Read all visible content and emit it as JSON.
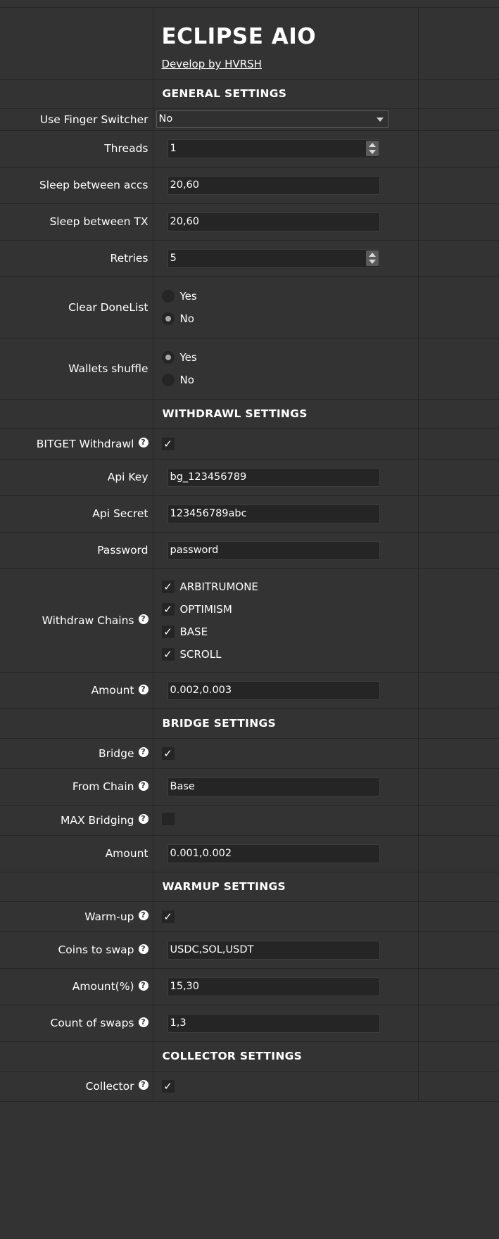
{
  "app": {
    "title": "ECLIPSE AIO",
    "author": "Develop by HVRSH"
  },
  "general": {
    "heading": "GENERAL SETTINGS",
    "finger_switcher": {
      "label": "Use Finger Switcher",
      "value": "No"
    },
    "threads": {
      "label": "Threads",
      "value": "1"
    },
    "sleep_accs": {
      "label": "Sleep between accs",
      "value": "20,60"
    },
    "sleep_tx": {
      "label": "Sleep between TX",
      "value": "20,60"
    },
    "retries": {
      "label": "Retries",
      "value": "5"
    },
    "clear_donelist": {
      "label": "Clear DoneList",
      "options": [
        "Yes",
        "No"
      ],
      "selected": "No"
    },
    "wallets_shuffle": {
      "label": "Wallets shuffle",
      "options": [
        "Yes",
        "No"
      ],
      "selected": "Yes"
    }
  },
  "withdrawl": {
    "heading": "WITHDRAWL SETTINGS",
    "bitget": {
      "label": "BITGET Withdrawl",
      "checked": true
    },
    "api_key": {
      "label": "Api Key",
      "value": "bg_123456789"
    },
    "api_secret": {
      "label": "Api Secret",
      "value": "123456789abc"
    },
    "password": {
      "label": "Password",
      "value": "password"
    },
    "chains": {
      "label": "Withdraw Chains",
      "options": [
        "ARBITRUMONE",
        "OPTIMISM",
        "BASE",
        "SCROLL"
      ]
    },
    "amount": {
      "label": "Amount",
      "value": "0.002,0.003"
    }
  },
  "bridge": {
    "heading": "BRIDGE SETTINGS",
    "bridge": {
      "label": "Bridge",
      "checked": true
    },
    "from_chain": {
      "label": "From Chain",
      "value": "Base"
    },
    "max_bridging": {
      "label": "MAX Bridging",
      "checked": false
    },
    "amount": {
      "label": "Amount",
      "value": "0.001,0.002"
    }
  },
  "warmup": {
    "heading": "WARMUP SETTINGS",
    "warmup": {
      "label": "Warm-up",
      "checked": true
    },
    "coins": {
      "label": "Coins to swap",
      "value": "USDC,SOL,USDT"
    },
    "amount_pct": {
      "label": "Amount(%)",
      "value": "15,30"
    },
    "count_swaps": {
      "label": "Count of swaps",
      "value": "1,3"
    }
  },
  "collector": {
    "heading": "COLLECTOR SETTINGS",
    "collector": {
      "label": "Collector",
      "checked": true
    }
  },
  "icons": {
    "help": "?",
    "check": "✓"
  }
}
